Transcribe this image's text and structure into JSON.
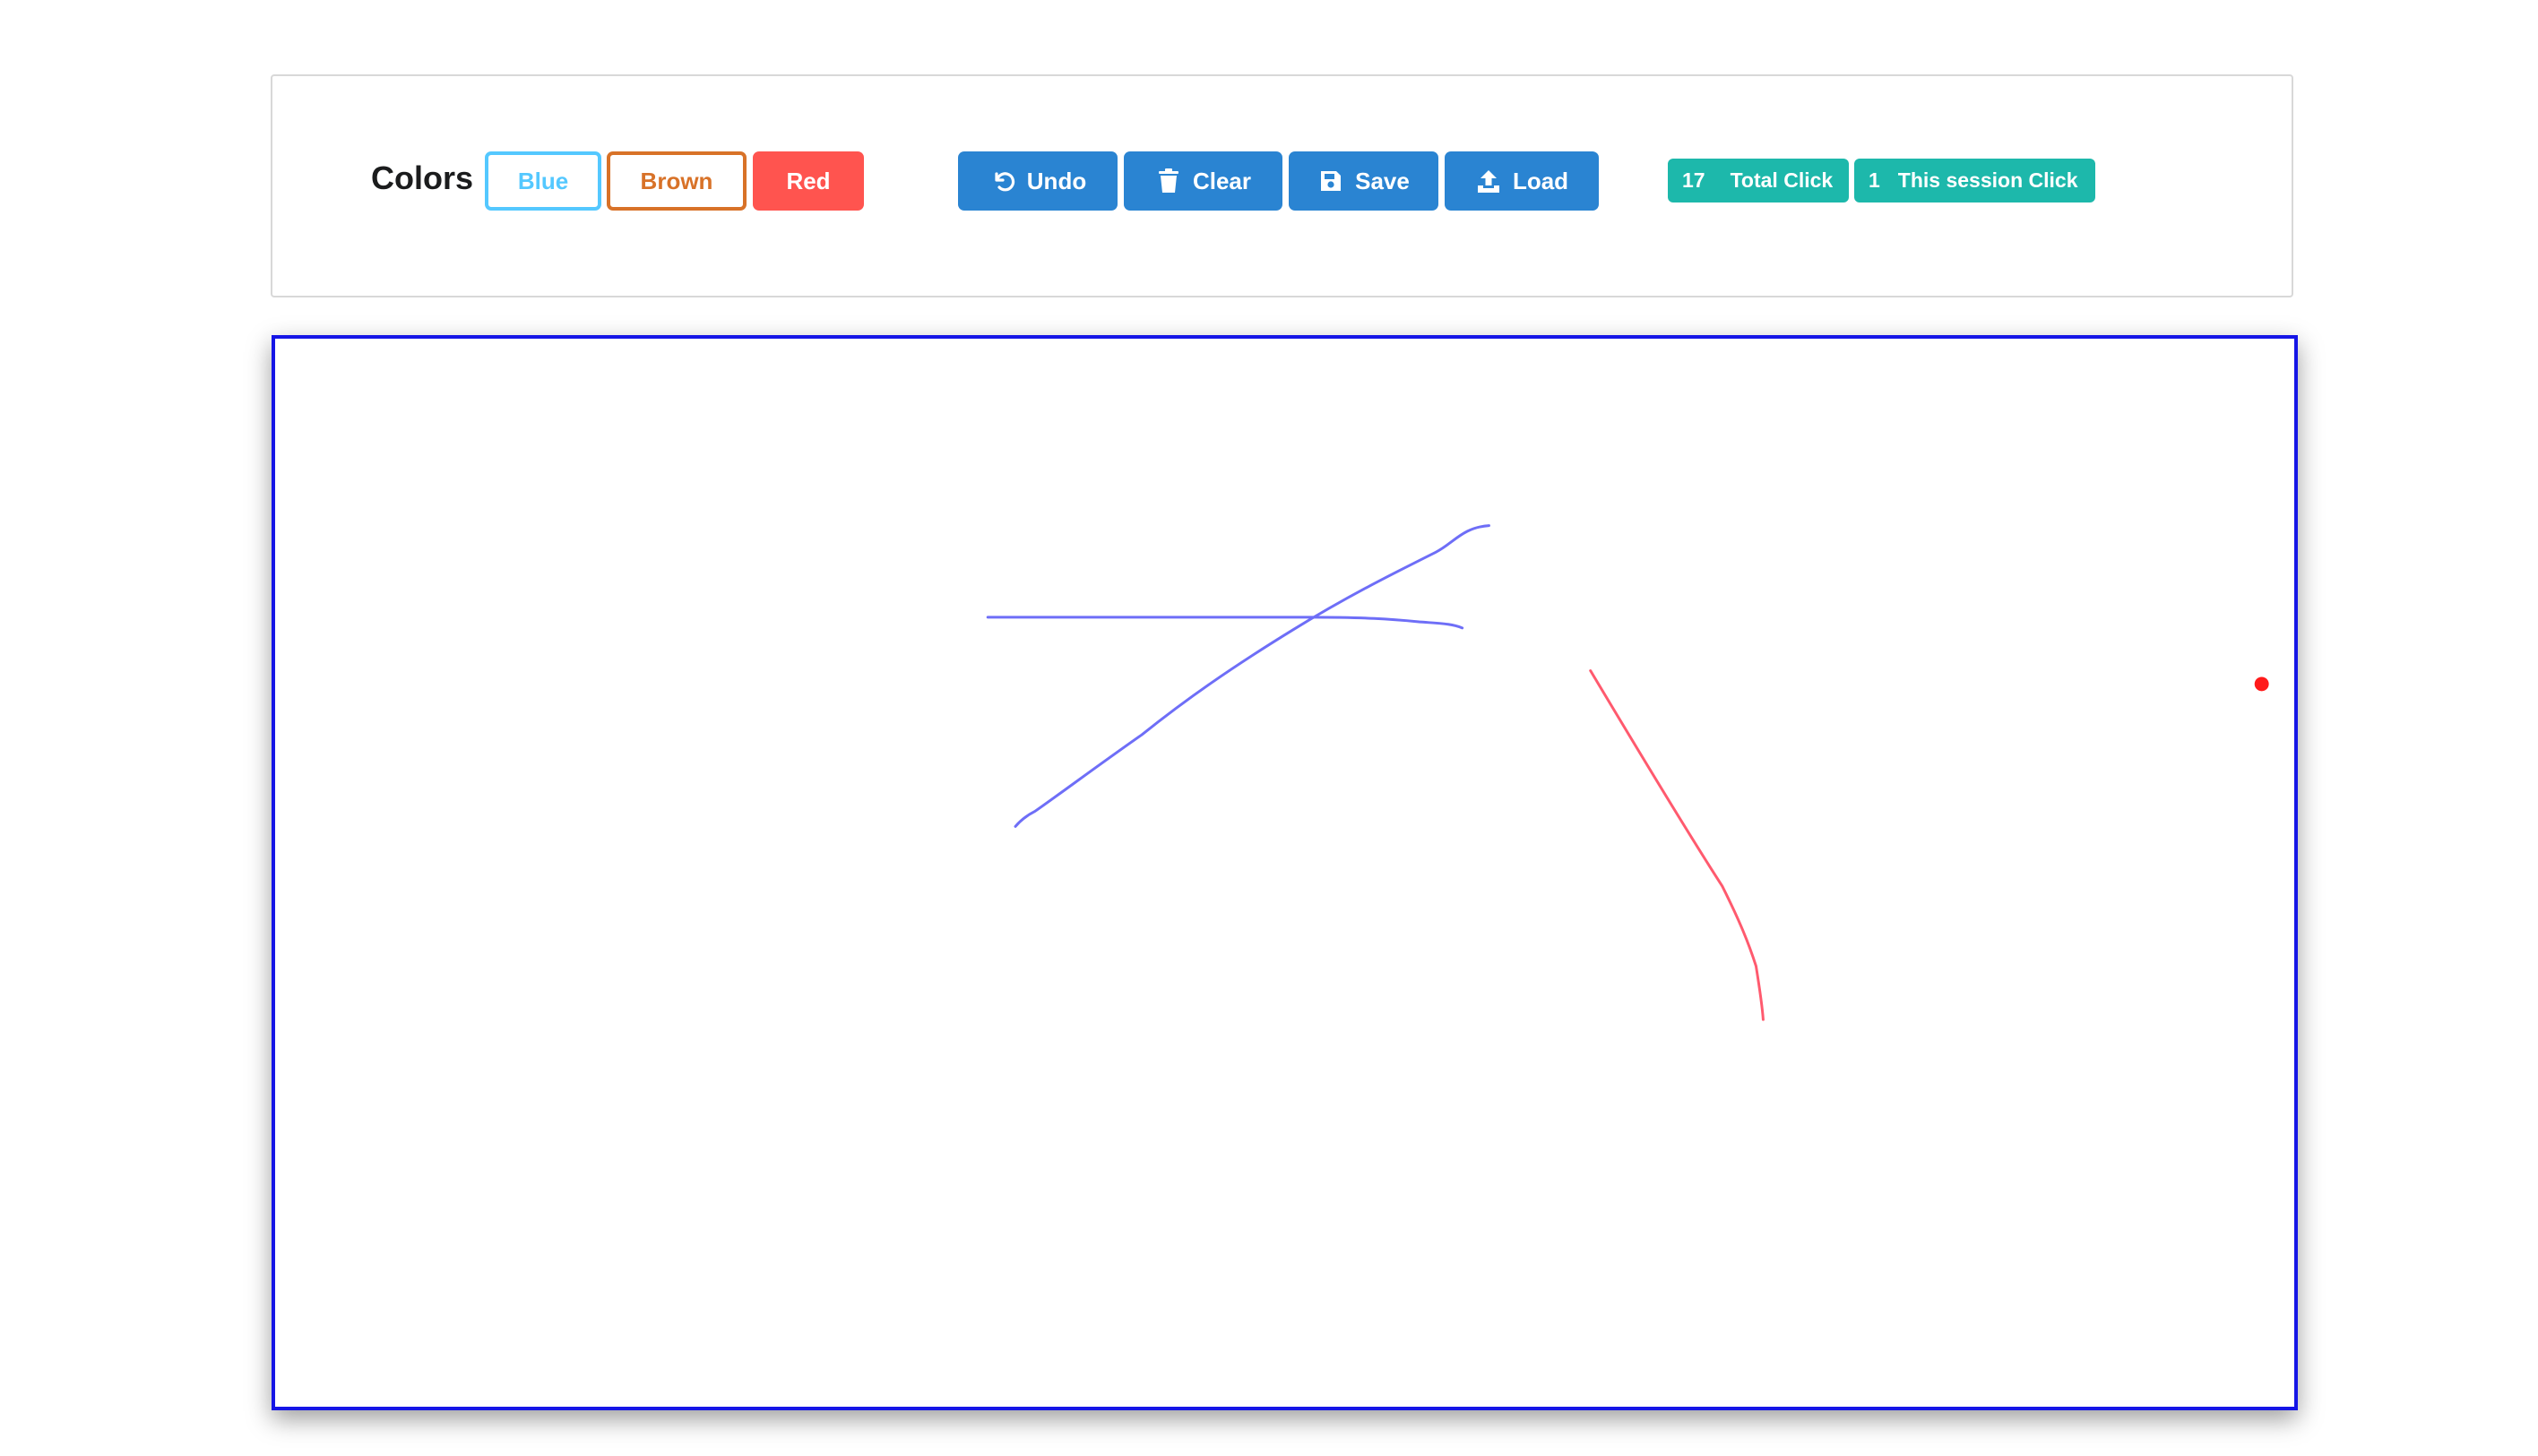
{
  "toolbar": {
    "colors_label": "Colors",
    "color_buttons": [
      {
        "label": "Blue",
        "color": "#54c8ff"
      },
      {
        "label": "Brown",
        "color": "#d87228"
      },
      {
        "label": "Red",
        "color": "#ff544f"
      }
    ],
    "actions": {
      "undo_label": "Undo",
      "undo_icon": "undo-icon",
      "clear_label": "Clear",
      "clear_icon": "trash-icon",
      "save_label": "Save",
      "save_icon": "save-icon",
      "load_label": "Load",
      "load_icon": "upload-icon",
      "action_color": "#2a84d2"
    },
    "counters": {
      "total_count": "17",
      "total_label": "Total Click",
      "session_count": "1",
      "session_label": "This session Click",
      "badge_color": "#1db8ab"
    }
  },
  "canvas": {
    "border_color": "#1515e6",
    "strokes": [
      {
        "color": "#6e6ef7",
        "description": "blue horizontal stroke"
      },
      {
        "color": "#6e6ef7",
        "description": "blue diagonal stroke"
      },
      {
        "color": "#ff5a6e",
        "description": "red curved stroke"
      }
    ],
    "cursor_dot_color": "#ff1a1a"
  }
}
